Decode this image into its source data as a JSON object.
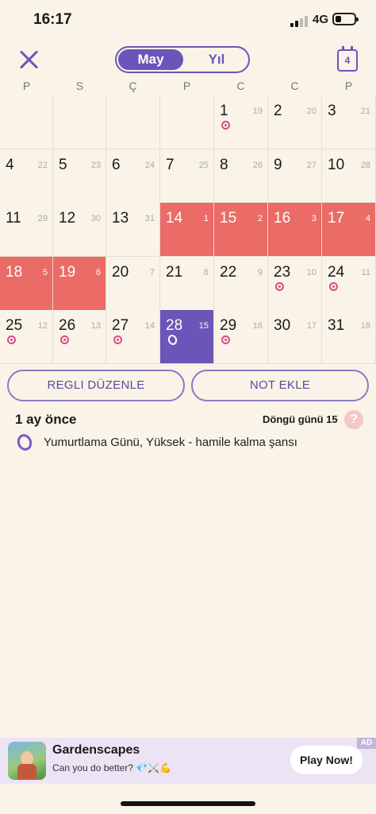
{
  "status": {
    "time": "16:17",
    "network": "4G"
  },
  "header": {
    "segments": [
      "May",
      "Yıl"
    ],
    "calendar_icon_day": "4"
  },
  "weekdays": [
    "P",
    "S",
    "Ç",
    "P",
    "C",
    "C",
    "P"
  ],
  "calendar": {
    "rows": [
      [
        {
          "empty": true
        },
        {
          "empty": true
        },
        {
          "empty": true
        },
        {
          "empty": true
        },
        {
          "day": "1",
          "cycle": "19",
          "dot": true
        },
        {
          "day": "2",
          "cycle": "20"
        },
        {
          "day": "3",
          "cycle": "21"
        }
      ],
      [
        {
          "day": "4",
          "cycle": "22"
        },
        {
          "day": "5",
          "cycle": "23"
        },
        {
          "day": "6",
          "cycle": "24"
        },
        {
          "day": "7",
          "cycle": "25"
        },
        {
          "day": "8",
          "cycle": "26"
        },
        {
          "day": "9",
          "cycle": "27"
        },
        {
          "day": "10",
          "cycle": "28"
        }
      ],
      [
        {
          "day": "11",
          "cycle": "29"
        },
        {
          "day": "12",
          "cycle": "30"
        },
        {
          "day": "13",
          "cycle": "31"
        },
        {
          "day": "14",
          "cycle": "1",
          "period": true
        },
        {
          "day": "15",
          "cycle": "2",
          "period": true
        },
        {
          "day": "16",
          "cycle": "3",
          "period": true
        },
        {
          "day": "17",
          "cycle": "4",
          "period": true
        }
      ],
      [
        {
          "day": "18",
          "cycle": "5",
          "period": true
        },
        {
          "day": "19",
          "cycle": "6",
          "period": true
        },
        {
          "day": "20",
          "cycle": "7"
        },
        {
          "day": "21",
          "cycle": "8"
        },
        {
          "day": "22",
          "cycle": "9"
        },
        {
          "day": "23",
          "cycle": "10",
          "dot": true
        },
        {
          "day": "24",
          "cycle": "11",
          "dot": true
        }
      ],
      [
        {
          "day": "25",
          "cycle": "12",
          "dot": true
        },
        {
          "day": "26",
          "cycle": "13",
          "dot": true
        },
        {
          "day": "27",
          "cycle": "14",
          "dot": true
        },
        {
          "day": "28",
          "cycle": "15",
          "today": true,
          "ovulation": true
        },
        {
          "day": "29",
          "cycle": "16",
          "dot": true
        },
        {
          "day": "30",
          "cycle": "17"
        },
        {
          "day": "31",
          "cycle": "18"
        }
      ]
    ]
  },
  "actions": {
    "edit_period": "REGLI DÜZENLE",
    "add_note": "NOT EKLE"
  },
  "info": {
    "ago": "1 ay önce",
    "cycle_day": "Döngü günü 15",
    "help": "?",
    "ovulation_text": "Yumurtlama Günü, Yüksek - hamile kalma şansı"
  },
  "ad": {
    "badge": "AD",
    "title": "Gardenscapes",
    "subtitle": "Can you do better? 💎⚔️💪",
    "cta": "Play Now!"
  },
  "colors": {
    "accent": "#6b55b8",
    "period": "#eb6b66",
    "fertile": "#d94d86",
    "background": "#faf3e8"
  }
}
